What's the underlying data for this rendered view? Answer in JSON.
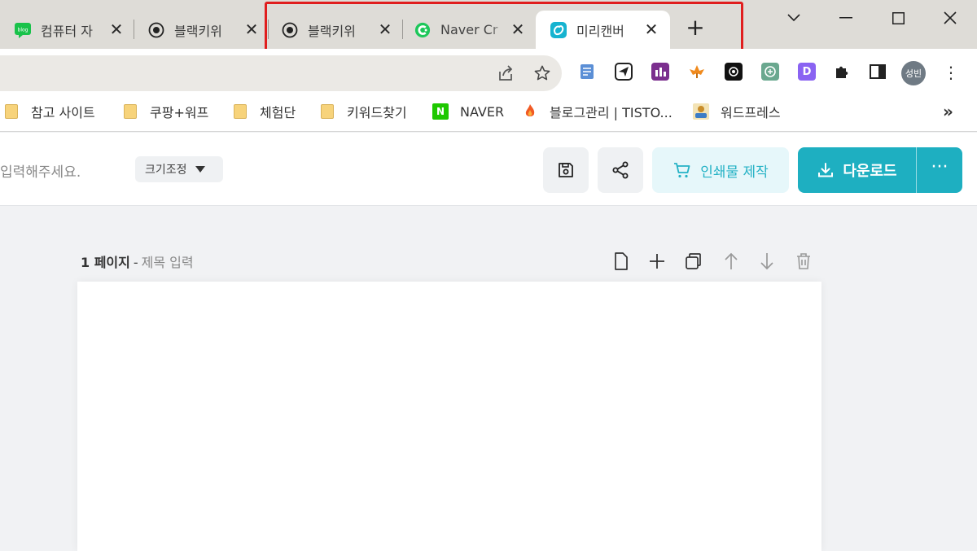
{
  "browser": {
    "tabs": [
      {
        "title": "컴퓨터 자",
        "favicon": "blog-icon"
      },
      {
        "title": "블랙키위",
        "favicon": "record-icon"
      },
      {
        "title": "블랙키위",
        "favicon": "record-icon"
      },
      {
        "title": "Naver Cr",
        "favicon": "c-logo-icon"
      },
      {
        "title": "미리캔버",
        "favicon": "miricanvas-icon",
        "active": true
      }
    ],
    "tab_favicon_label": "blog",
    "new_tab_symbol": "+",
    "highlight_color": "#e01e1e"
  },
  "toolbar": {
    "avatar_label": "성빈",
    "extensions": [
      "docs-icon",
      "send-icon",
      "analytics-icon",
      "leaf-icon",
      "chip-icon",
      "chatgpt-icon",
      "d-icon",
      "puzzle-icon",
      "sidepanel-icon"
    ],
    "ext_d_label": "D"
  },
  "bookmarks": {
    "items": [
      {
        "label": "참고 사이트",
        "icon": "folder-icon"
      },
      {
        "label": "쿠팡+워프",
        "icon": "folder-icon"
      },
      {
        "label": "체험단",
        "icon": "folder-icon"
      },
      {
        "label": "키워드찾기",
        "icon": "folder-icon"
      },
      {
        "label": "NAVER",
        "icon": "naver-icon"
      },
      {
        "label": "블로그관리 | TISTO...",
        "icon": "tistory-icon"
      },
      {
        "label": "워드프레스",
        "icon": "wordpress-icon"
      }
    ],
    "naver_icon_label": "N",
    "overflow": "»"
  },
  "editor": {
    "title_placeholder": "입력해주세요.",
    "size_button": "크기조정",
    "print_button": "인쇄물 제작",
    "download_button": "다운로드",
    "more_button": "···",
    "accent_color": "#1eafc1"
  },
  "page": {
    "number_label": "1 페이지",
    "separator": "-",
    "title_placeholder": "제목 입력"
  }
}
